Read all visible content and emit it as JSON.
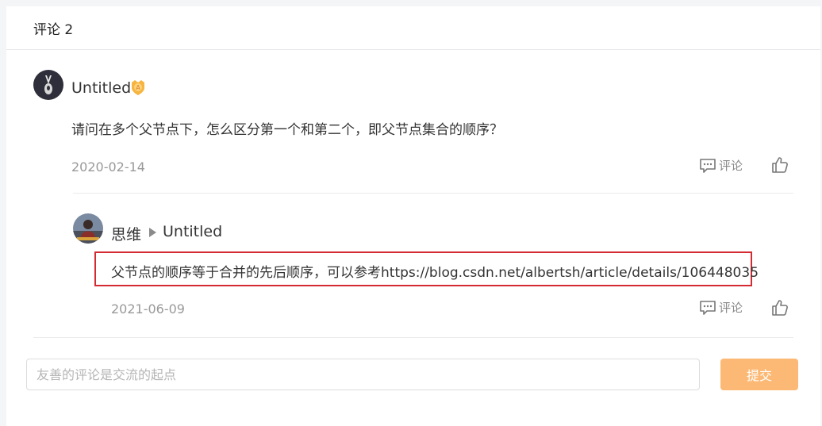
{
  "header": {
    "title": "评论 2"
  },
  "comments": [
    {
      "user": "Untitled",
      "text": "请问在多个父节点下，怎么区分第一个和第二个，即父节点集合的顺序？",
      "date": "2020-02-14",
      "comment_label": "评论"
    }
  ],
  "reply": {
    "user": "思维",
    "reply_to": "Untitled",
    "text": "父节点的顺序等于合并的先后顺序，可以参考https://blog.csdn.net/albertsh/article/details/106448035",
    "date": "2021-06-09",
    "comment_label": "评论"
  },
  "composer": {
    "placeholder": "友善的评论是交流的起点",
    "submit_label": "提交"
  },
  "colors": {
    "highlight": "#d42a32",
    "submit": "#fcb975"
  }
}
